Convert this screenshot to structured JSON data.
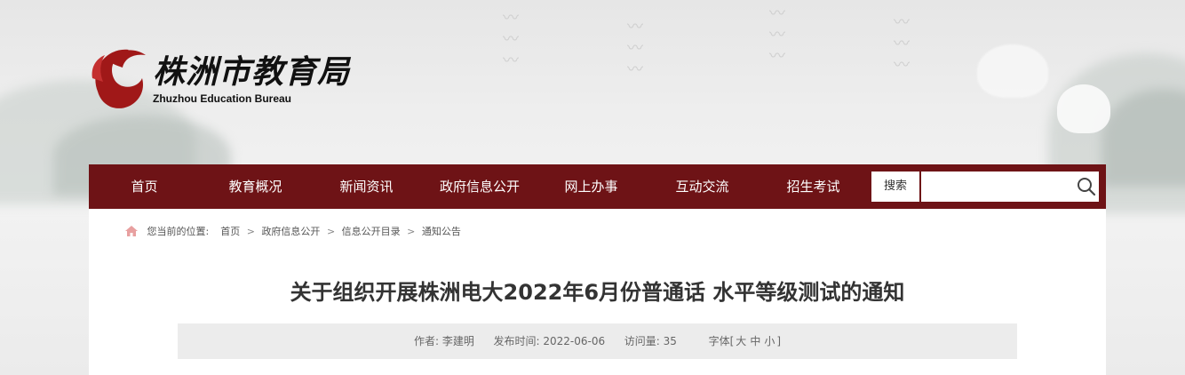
{
  "header": {
    "logo_cn": "株洲市教育局",
    "logo_en": "Zhuzhou Education Bureau"
  },
  "nav": {
    "items": [
      "首页",
      "教育概况",
      "新闻资讯",
      "政府信息公开",
      "网上办事",
      "互动交流",
      "招生考试"
    ],
    "search_label": "搜索",
    "search_value": "",
    "search_placeholder": ""
  },
  "breadcrumb": {
    "prefix": "您当前的位置:",
    "items": [
      "首页",
      "政府信息公开",
      "信息公开目录",
      "通知公告"
    ],
    "separator": ">"
  },
  "article": {
    "title": "关于组织开展株洲电大2022年6月份普通话 水平等级测试的通知",
    "author_label": "作者:",
    "author": "李建明",
    "date_label": "发布时间:",
    "date": "2022-06-06",
    "views_label": "访问量:",
    "views": "35",
    "font_size_label": "字体[",
    "font_large": "大",
    "font_medium": "中",
    "font_small": "小",
    "font_size_close": "]"
  },
  "colors": {
    "nav_bg": "#6e1316",
    "logo_red": "#a01818"
  }
}
